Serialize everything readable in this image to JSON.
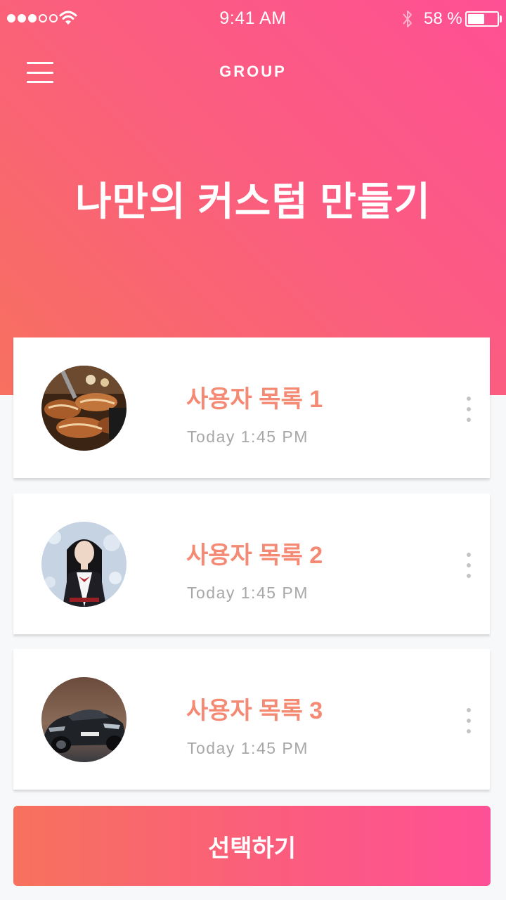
{
  "status_bar": {
    "time": "9:41 AM",
    "battery_percent": "58 %",
    "battery_level": 0.58,
    "signal_bars_filled": 3,
    "signal_bars_total": 5
  },
  "header": {
    "menu_icon": "hamburger-menu-icon",
    "title": "GROUP",
    "hero_title": "나만의 커스텀 만들기"
  },
  "colors": {
    "gradient_start": "#f7705f",
    "gradient_end": "#fe5094",
    "item_title": "#f58a74",
    "item_time": "#a7a7a7"
  },
  "list": {
    "items": [
      {
        "title": "사용자 목록 1",
        "time": "Today 1:45 PM",
        "image": "grilled-meat-photo",
        "more_icon": "more-vertical-icon"
      },
      {
        "title": "사용자 목록 2",
        "time": "Today 1:45 PM",
        "image": "portrait-photo",
        "more_icon": "more-vertical-icon"
      },
      {
        "title": "사용자 목록 3",
        "time": "Today 1:45 PM",
        "image": "car-photo",
        "more_icon": "more-vertical-icon"
      }
    ]
  },
  "footer": {
    "select_label": "선택하기"
  }
}
